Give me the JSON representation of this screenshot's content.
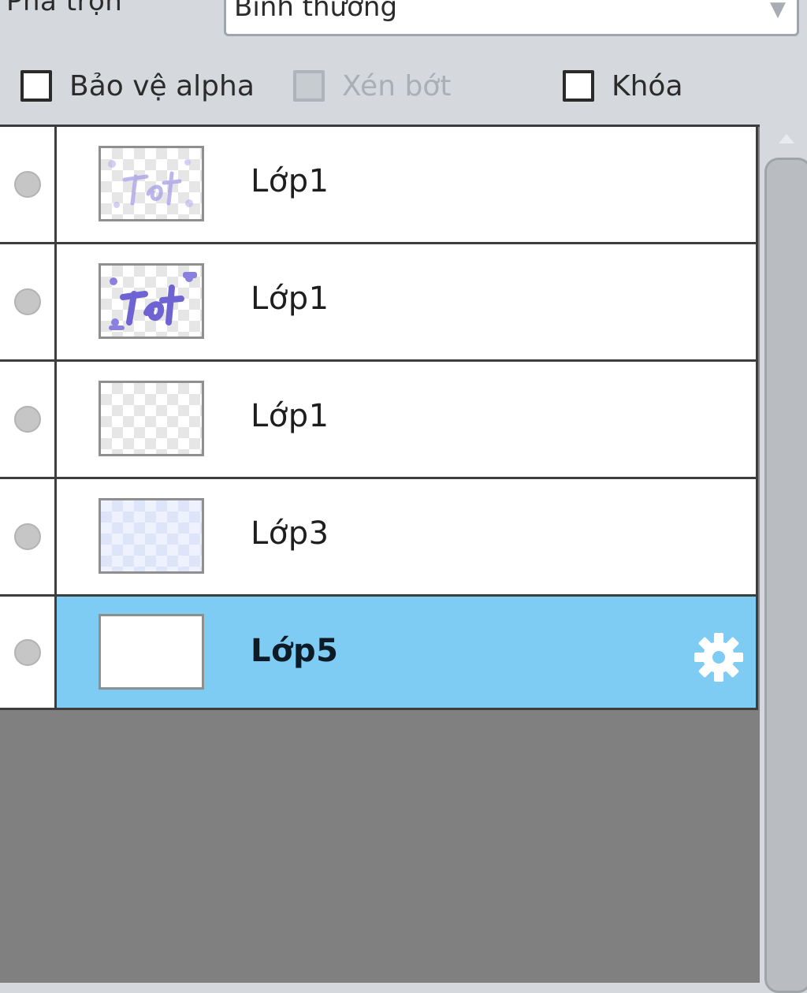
{
  "blend": {
    "label": "Pha trộn",
    "value": "Bình thường"
  },
  "options": {
    "alpha_protect": {
      "label": "Bảo vệ alpha",
      "checked": false,
      "enabled": true
    },
    "clip": {
      "label": "Xén bớt",
      "checked": false,
      "enabled": false
    },
    "lock": {
      "label": "Khóa",
      "checked": false,
      "enabled": true
    }
  },
  "layers": [
    {
      "name": "Lớp1",
      "selected": false,
      "thumbnail": "faint-purple-lettering"
    },
    {
      "name": "Lớp1",
      "selected": false,
      "thumbnail": "purple-lettering"
    },
    {
      "name": "Lớp1",
      "selected": false,
      "thumbnail": "transparent"
    },
    {
      "name": "Lớp3",
      "selected": false,
      "thumbnail": "light-blue-fill"
    },
    {
      "name": "Lớp5",
      "selected": true,
      "thumbnail": "white-fill",
      "icon": "gear-icon"
    }
  ],
  "colors": {
    "selected_row": "#7ecbf3",
    "panel_background": "#808080",
    "lettering": "#7d72d8"
  }
}
